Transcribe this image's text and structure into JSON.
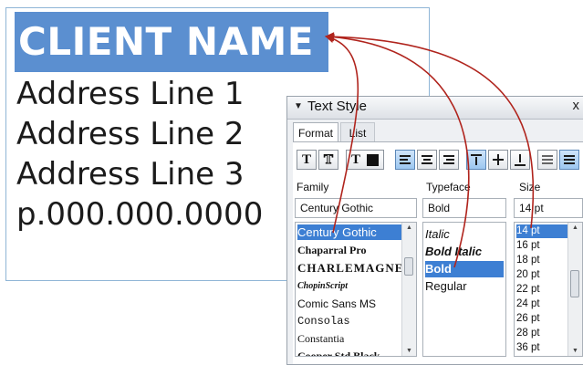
{
  "document": {
    "client_name": "CLIENT NAME",
    "address_lines": [
      "Address Line 1",
      "Address Line 2",
      "Address Line 3",
      "p.000.000.0000"
    ]
  },
  "panel": {
    "title": "Text Style",
    "close": "x",
    "collapse": "▼",
    "tabs": [
      "Format",
      "List"
    ],
    "family": {
      "label": "Family",
      "value": "Century Gothic",
      "items": [
        "Century Gothic",
        "Chaparral Pro",
        "CHARLEMAGNE",
        "ChopinScript",
        "Comic Sans MS",
        "Consolas",
        "Constantia",
        "Cooper Std Black"
      ]
    },
    "typeface": {
      "label": "Typeface",
      "value": "Bold",
      "items": [
        "Italic",
        "Bold Italic",
        "Bold",
        "Regular"
      ]
    },
    "size": {
      "label": "Size",
      "value": "14 pt",
      "items": [
        "14 pt",
        "16 pt",
        "18 pt",
        "20 pt",
        "22 pt",
        "24 pt",
        "26 pt",
        "28 pt",
        "36 pt"
      ]
    }
  },
  "colors": {
    "highlight": "#5b8fd0",
    "selection": "#3d7fd3",
    "arrow": "#b0241d"
  }
}
